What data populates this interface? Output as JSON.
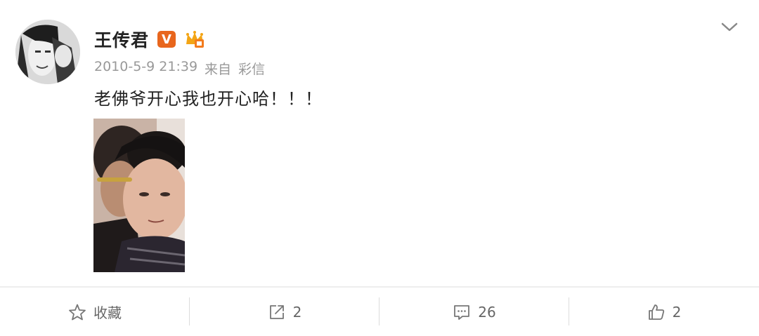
{
  "post": {
    "username": "王传君",
    "verified_badge": "V",
    "timestamp": "2010-5-9 21:39",
    "source_prefix": "来自",
    "source": "彩信",
    "text": "老佛爷开心我也开心哈！！！"
  },
  "icons": {
    "avatar": "avatar-photo",
    "vip": "crown-icon",
    "menu": "chevron-down-icon"
  },
  "actions": [
    {
      "icon": "star-icon",
      "label": "收藏"
    },
    {
      "icon": "share-icon",
      "label": "2"
    },
    {
      "icon": "comment-icon",
      "label": "26"
    },
    {
      "icon": "thumbs-up-icon",
      "label": "2"
    }
  ],
  "colors": {
    "badge": "#e8661d",
    "meta_text": "#999999",
    "action_text": "#666666"
  }
}
